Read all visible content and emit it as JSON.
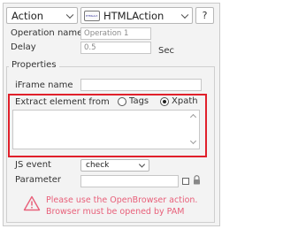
{
  "header": {
    "type_select": "Action",
    "action_select": "HTMLAction",
    "action_icon_text": "HTMLAct",
    "help_label": "?"
  },
  "fields": {
    "operation_name_label": "Operation name",
    "operation_name_value": "Operation 1",
    "delay_label": "Delay",
    "delay_value": "0.5",
    "delay_unit": "Sec"
  },
  "properties": {
    "title": "Properties",
    "iframe_label": "iFrame name",
    "iframe_value": "",
    "extract_label": "Extract element from",
    "option_tags": "Tags",
    "option_xpath": "Xpath",
    "selected_option": "Xpath",
    "extract_value": "",
    "js_event_label": "JS event",
    "js_event_value": "check",
    "parameter_label": "Parameter",
    "parameter_value": ""
  },
  "warning": {
    "line1": "Please use the OpenBrowser action.",
    "line2": "Browser must be opened by PAM",
    "color": "#e8607a"
  },
  "accent": {
    "highlight_border": "#e0202b"
  }
}
